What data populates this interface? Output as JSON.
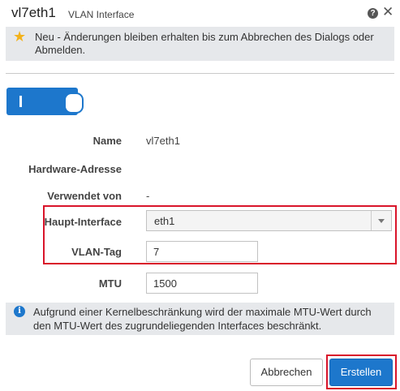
{
  "dialog": {
    "title": "vl7eth1",
    "subtitle": "VLAN Interface",
    "help_icon": "?",
    "close_icon": "✕"
  },
  "notice": {
    "icon": "star-icon",
    "text": "Neu - Änderungen bleiben erhalten bis zum Abbrechen des Dialogs oder Abmelden."
  },
  "toggle": {
    "state": "on"
  },
  "fields": {
    "name_label": "Name",
    "name_value": "vl7eth1",
    "hw_label": "Hardware-Adresse",
    "hw_value": "",
    "used_label": "Verwendet von",
    "used_value": "-",
    "parent_label": "Haupt-Interface",
    "parent_value": "eth1",
    "vlan_label": "VLAN-Tag",
    "vlan_value": "7",
    "mtu_label": "MTU",
    "mtu_value": "1500"
  },
  "info": {
    "icon": "info-icon",
    "text": "Aufgrund einer Kernelbeschränkung wird der maximale MTU-Wert durch den MTU-Wert des zugrundeliegenden Interfaces beschränkt."
  },
  "buttons": {
    "cancel": "Abbrechen",
    "create": "Erstellen"
  },
  "colors": {
    "accent": "#1d77cc",
    "highlight": "#d9142a",
    "notice_bg": "#e6e8eb"
  }
}
